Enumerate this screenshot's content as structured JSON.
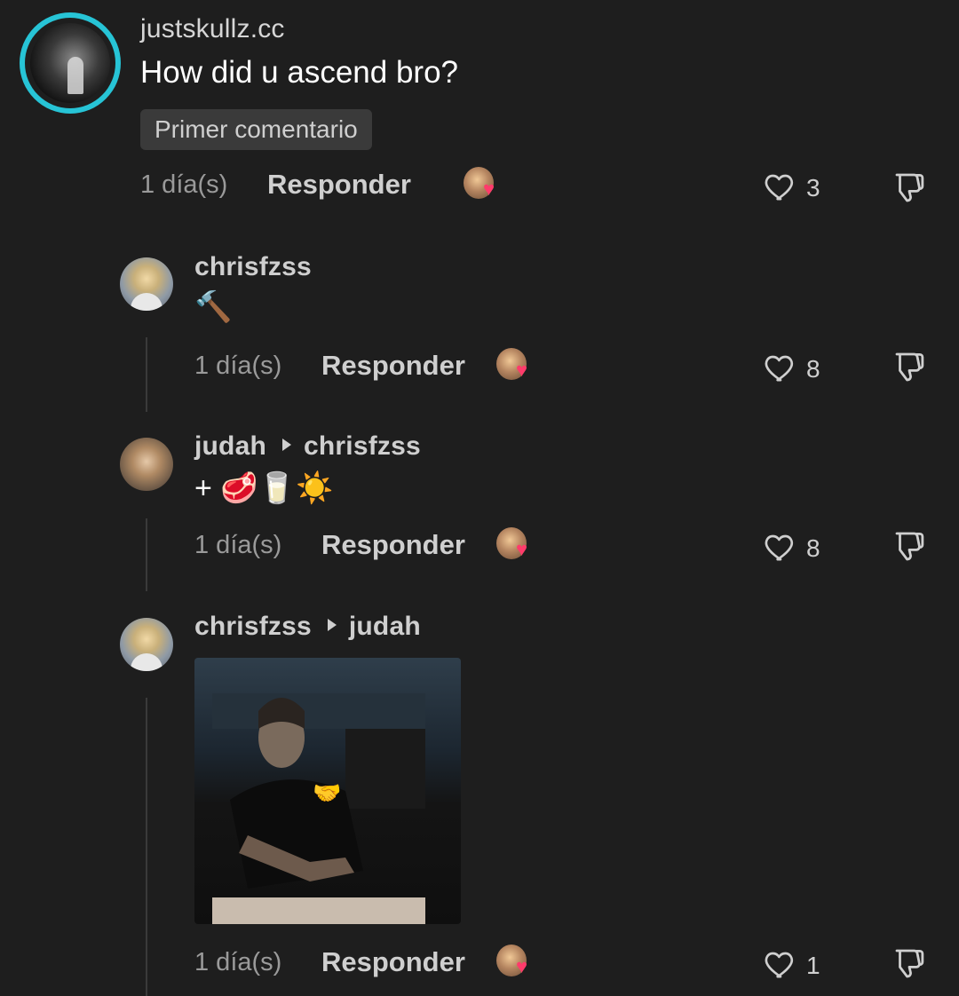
{
  "comments": [
    {
      "username": "justskullz.cc",
      "text": "How did u ascend bro?",
      "badge": "Primer comentario",
      "time": "1 día(s)",
      "reply_label": "Responder",
      "likes": "3"
    },
    {
      "username": "chrisfzss",
      "emoji": "🔨",
      "time": "1 día(s)",
      "reply_label": "Responder",
      "likes": "8"
    },
    {
      "username": "judah",
      "reply_to": "chrisfzss",
      "emoji": "+ 🥩🥛☀️",
      "time": "1 día(s)",
      "reply_label": "Responder",
      "likes": "8"
    },
    {
      "username": "chrisfzss",
      "reply_to": "judah",
      "gif_emoji": "🤝",
      "time": "1 día(s)",
      "reply_label": "Responder",
      "likes": "1"
    }
  ],
  "icons": {
    "like": "heart-outline-icon",
    "dislike": "thumbs-down-icon",
    "creator_reaction": "creator-liked-icon",
    "reply_arrow": "reply-arrow-icon"
  },
  "colors": {
    "background": "#1e1e1e",
    "story_ring": "#27c4d6",
    "heart": "#ff3b6b"
  }
}
